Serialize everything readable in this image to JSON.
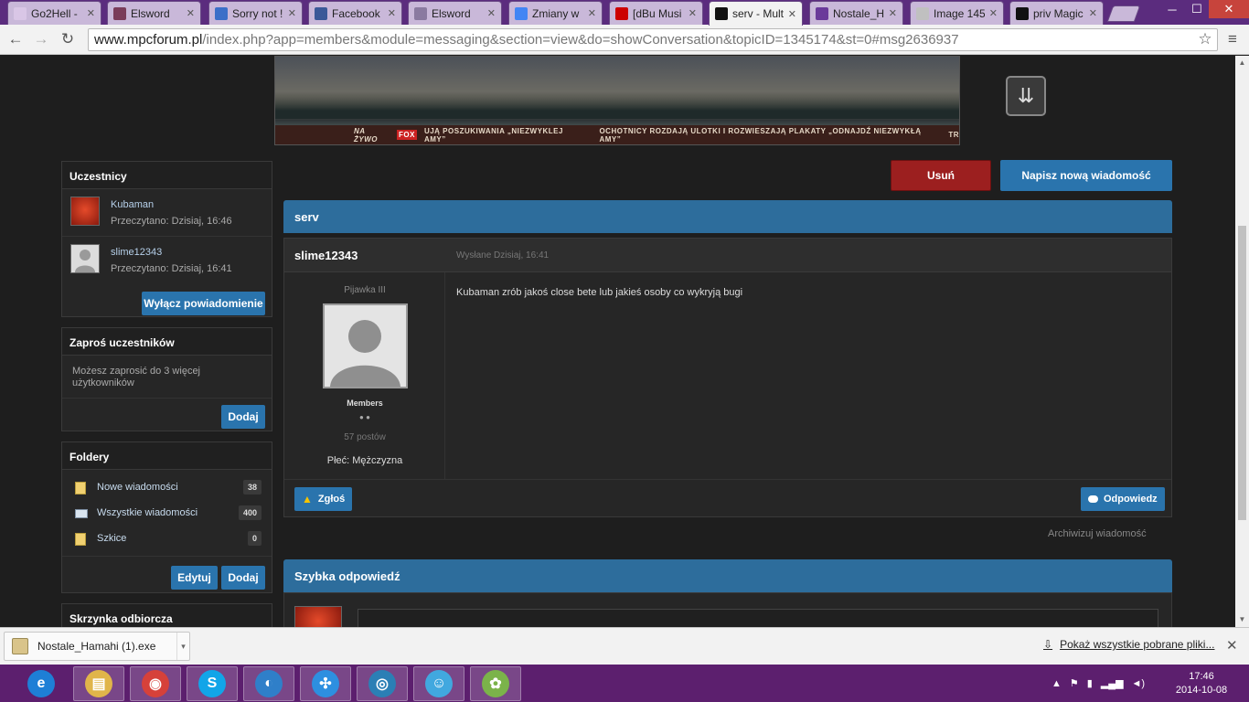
{
  "browser": {
    "tabs": [
      {
        "label": "Go2Hell -",
        "fav": "#d9c6e6"
      },
      {
        "label": "Elsword",
        "fav": "#7a3c5a"
      },
      {
        "label": "Sorry not !",
        "fav": "#3b6fc8"
      },
      {
        "label": "Facebook",
        "fav": "#3b5998"
      },
      {
        "label": "Elsword",
        "fav": "#8a7aa0"
      },
      {
        "label": "Zmiany w",
        "fav": "#4285f4"
      },
      {
        "label": "[dBu Musi",
        "fav": "#cc0000"
      },
      {
        "label": "serv - Mult",
        "fav": "#111111"
      },
      {
        "label": "Nostale_H",
        "fav": "#6a3a9a"
      },
      {
        "label": "Image 145",
        "fav": "#c0c0c0"
      },
      {
        "label": "priv Magic",
        "fav": "#111111"
      }
    ],
    "url_host": "www.mpcforum.pl",
    "url_path": "/index.php?app=members&module=messaging&section=view&do=showConversation&topicID=1345174&st=0#msg2636937",
    "back_icon": "←",
    "forward_icon": "→",
    "reload_icon": "↻",
    "star_icon": "☆",
    "menu_icon": "≡",
    "win_min": "─",
    "win_max": "☐",
    "win_close": "✕"
  },
  "banner": {
    "live": "NA ŻYWO",
    "fox": "FOX",
    "ticker1": "UJĄ POSZUKIWANIA „NIEZWYKLEJ AMY”",
    "ticker2": "OCHOTNICY ROZDAJĄ ULOTKI I ROZWIESZAJĄ PLAKATY „ODNAJDŹ NIEZWYKŁĄ AMY”",
    "ticker3": "TR",
    "scroll_icon": "⇊"
  },
  "sidebar": {
    "participants": {
      "title": "Uczestnicy",
      "items": [
        {
          "name": "Kubaman",
          "read": "Przeczytano: Dzisiaj, 16:46"
        },
        {
          "name": "slime12343",
          "read": "Przeczytano: Dzisiaj, 16:41"
        }
      ],
      "notify_button": "Wyłącz powiadomienie"
    },
    "invite": {
      "title": "Zaproś uczestników",
      "text": "Możesz zaprosić do 3 więcej użytkowników",
      "button": "Dodaj"
    },
    "folders": {
      "title": "Foldery",
      "items": [
        {
          "label": "Nowe wiadomości",
          "count": "38"
        },
        {
          "label": "Wszystkie wiadomości",
          "count": "400"
        },
        {
          "label": "Szkice",
          "count": "0"
        }
      ],
      "edit_button": "Edytuj",
      "add_button": "Dodaj"
    },
    "inbox": {
      "title": "Skrzynka odbiorcza"
    }
  },
  "actions": {
    "delete": "Usuń",
    "new_message": "Napisz nową wiadomość"
  },
  "conversation": {
    "title": "serv",
    "post": {
      "author": "slime12343",
      "sent": "Wysłane Dzisiaj, 16:41",
      "rank": "Pijawka III",
      "group": "Members",
      "pips": "● ●",
      "posts": "57 postów",
      "gender": "Płeć: Mężczyzna",
      "body": "Kubaman zrób jakoś close bete lub jakieś osoby co wykryją bugi",
      "report": "Zgłoś",
      "reply": "Odpowiedz"
    },
    "archive": "Archiwizuj wiadomość",
    "quick_reply_title": "Szybka odpowiedź"
  },
  "downloads": {
    "file": "Nostale_Hamahi (1).exe",
    "chevron": "▾",
    "show_all": "Pokaż wszystkie pobrane pliki...",
    "download_icon": "⇩",
    "close": "✕"
  },
  "taskbar": {
    "clock_time": "17:46",
    "clock_date": "2014-10-08",
    "apps": [
      {
        "name": "ie",
        "glyph": "e",
        "color": "#1e7fd6"
      },
      {
        "name": "explorer",
        "glyph": "▤",
        "color": "#e0b54a"
      },
      {
        "name": "chrome",
        "glyph": "◉",
        "color": "#d6413a"
      },
      {
        "name": "skype",
        "glyph": "S",
        "color": "#12a5e8"
      },
      {
        "name": "app5",
        "glyph": "◐",
        "color": "#2f7fc9"
      },
      {
        "name": "app6",
        "glyph": "✣",
        "color": "#2d8fe0"
      },
      {
        "name": "app7",
        "glyph": "◎",
        "color": "#2b7fb5"
      },
      {
        "name": "app8",
        "glyph": "☺",
        "color": "#41a8df"
      },
      {
        "name": "app9",
        "glyph": "✿",
        "color": "#7bb34a"
      }
    ],
    "tray_icons": [
      "▲",
      "⚑",
      "▮",
      "▂▄▆",
      "◄)"
    ]
  }
}
